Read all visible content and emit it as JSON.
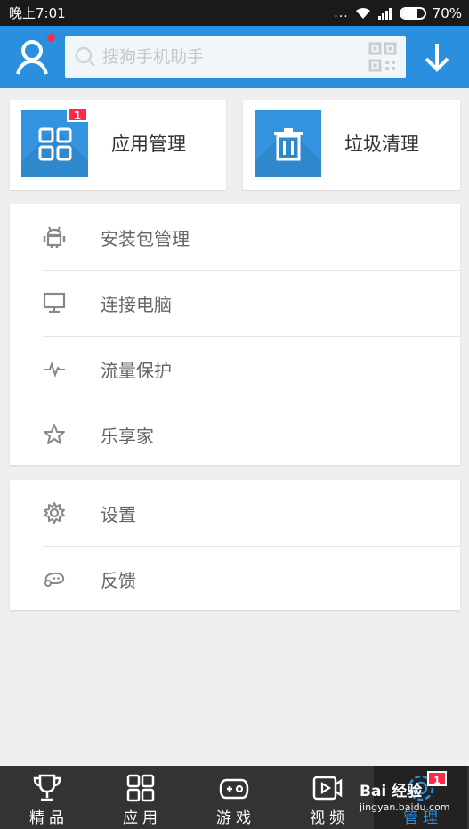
{
  "status_bar": {
    "time": "晚上7:01",
    "dots": "...",
    "battery": "70%",
    "battery_level": 0.7
  },
  "header": {
    "search_placeholder": "搜狗手机助手",
    "accent_color": "#2a8fdf"
  },
  "cards": [
    {
      "label": "应用管理",
      "badge": "1",
      "icon": "apps-grid-icon"
    },
    {
      "label": "垃圾清理",
      "icon": "trash-icon"
    }
  ],
  "menu_group_1": [
    {
      "label": "安装包管理",
      "icon": "android-icon"
    },
    {
      "label": "连接电脑",
      "icon": "monitor-icon"
    },
    {
      "label": "流量保护",
      "icon": "pulse-icon"
    },
    {
      "label": "乐享家",
      "icon": "star-icon"
    }
  ],
  "menu_group_2": [
    {
      "label": "设置",
      "icon": "gear-icon"
    },
    {
      "label": "反馈",
      "icon": "feedback-icon"
    }
  ],
  "bottom_nav": [
    {
      "label": "精品",
      "icon": "trophy-icon"
    },
    {
      "label": "应用",
      "icon": "apps-icon"
    },
    {
      "label": "游戏",
      "icon": "gamepad-icon"
    },
    {
      "label": "视频",
      "icon": "video-icon"
    },
    {
      "label": "管理",
      "icon": "manage-icon",
      "badge": "1",
      "active": true
    }
  ],
  "watermark": {
    "text": "Bai 经验",
    "url": "jingyan.baidu.com"
  }
}
